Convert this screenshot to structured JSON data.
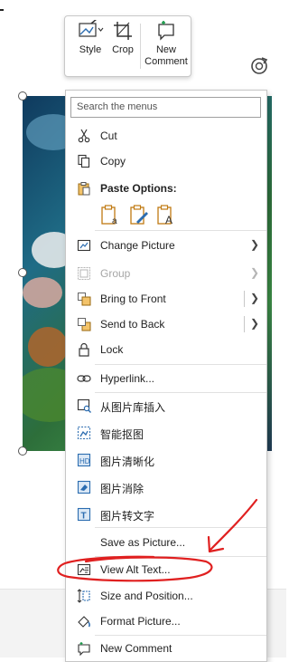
{
  "minibar": {
    "style_label": "Style",
    "crop_label": "Crop",
    "new_comment_label_1": "New",
    "new_comment_label_2": "Comment"
  },
  "menu": {
    "search_placeholder": "Search the menus",
    "cut": "Cut",
    "copy": "Copy",
    "paste_options": "Paste Options:",
    "change_picture": "Change Picture",
    "group": "Group",
    "bring_to_front": "Bring to Front",
    "send_to_back": "Send to Back",
    "lock": "Lock",
    "hyperlink": "Hyperlink...",
    "insert_from_library": "从图片库插入",
    "smart_cutout": "智能抠图",
    "sharpen": "图片清晰化",
    "erase": "图片消除",
    "to_text": "图片转文字",
    "save_as_picture": "Save as Picture...",
    "view_alt_text": "View Alt Text...",
    "size_and_position": "Size and Position...",
    "format_picture": "Format Picture...",
    "new_comment": "New Comment"
  },
  "colors": {
    "accent_blue": "#2b6cb0",
    "annotation_red": "#e02020",
    "paste_orange": "#c07a12"
  }
}
